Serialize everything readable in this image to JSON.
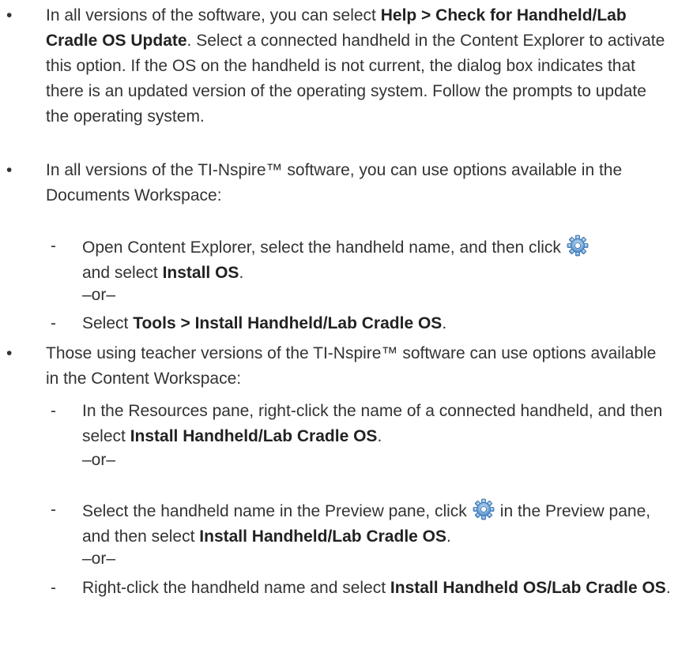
{
  "bullets": [
    {
      "parts": [
        "In all versions of the software, you can select ",
        "Help > Check for Handheld/Lab Cradle OS Update",
        ". Select a connected handheld in the Content Explorer to activate this option. If the OS on the handheld is not current, the dialog box indicates that there is an updated version of the operating system. Follow the prompts to update the operating system."
      ]
    },
    {
      "parts": [
        "In all versions of the TI-Nspire™ software, you can use options available in the Documents Workspace:"
      ],
      "subs": [
        {
          "a": "Open Content Explorer, select the handheld name, and then click",
          "b": "and select ",
          "bold": "Install OS",
          "end": "."
        },
        {
          "a": "Select ",
          "bold": "Tools > Install Handheld/Lab Cradle OS",
          "end": "."
        }
      ]
    },
    {
      "parts": [
        "Those using teacher versions of the TI-Nspire™ software can use options available in the Content Workspace:"
      ],
      "subs": [
        {
          "a": "In the Resources pane, right-click the name of a connected handheld, and then select ",
          "bold": "Install Handheld/Lab Cradle OS",
          "end": "."
        },
        {
          "a": "Select the handheld name in the Preview pane, click",
          "b": "in the Preview pane, and then select ",
          "bold": "Install Handheld/Lab Cradle OS",
          "end": "."
        },
        {
          "a": "Right-click the handheld name and select ",
          "bold": "Install Handheld OS/Lab Cradle OS",
          "end": "."
        }
      ]
    }
  ],
  "or_text": "–or–",
  "bullet_char": "•",
  "dash_char": "-",
  "icons": {
    "settings": "gear-icon"
  },
  "colors": {
    "text": "#333333",
    "gear_blue": "#5b9bd5"
  }
}
